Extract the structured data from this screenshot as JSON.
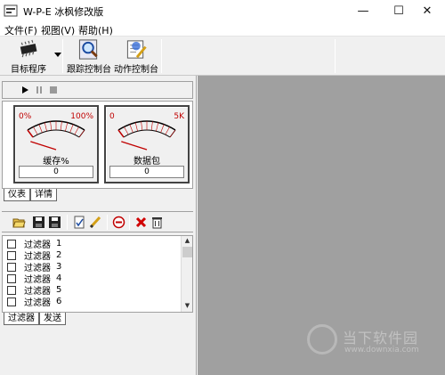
{
  "window": {
    "title": "W-P-E 冰枫修改版",
    "minimize_glyph": "—",
    "maximize_glyph": "☐",
    "close_glyph": "✕"
  },
  "menu": {
    "items": [
      {
        "label": "文件(F)"
      },
      {
        "label": "视图(V)"
      },
      {
        "label": "帮助(H)"
      }
    ]
  },
  "toolbar": {
    "target_label": "目标程序",
    "trace_label": "跟踪控制台",
    "action_label": "动作控制台"
  },
  "gauges": [
    {
      "min": "0%",
      "max": "100%",
      "label": "缓存%",
      "value": "0",
      "level": 0
    },
    {
      "min": "0",
      "max": "5K",
      "label": "数据包",
      "value": "0",
      "level": 0
    }
  ],
  "top_tabs": [
    {
      "label": "仪表"
    },
    {
      "label": "详情"
    }
  ],
  "filters": [
    {
      "label": "过滤器",
      "num": "1"
    },
    {
      "label": "过滤器",
      "num": "2"
    },
    {
      "label": "过滤器",
      "num": "3"
    },
    {
      "label": "过滤器",
      "num": "4"
    },
    {
      "label": "过滤器",
      "num": "5"
    },
    {
      "label": "过滤器",
      "num": "6"
    }
  ],
  "bottom_tabs": [
    {
      "label": "过滤器"
    },
    {
      "label": "发送"
    }
  ],
  "watermark": {
    "text": "当下软件园",
    "url": "www.downxia.com"
  },
  "colors": {
    "gauge_scale": "#c00000",
    "workspace": "#a0a0a0",
    "panel": "#f0f0f0"
  }
}
